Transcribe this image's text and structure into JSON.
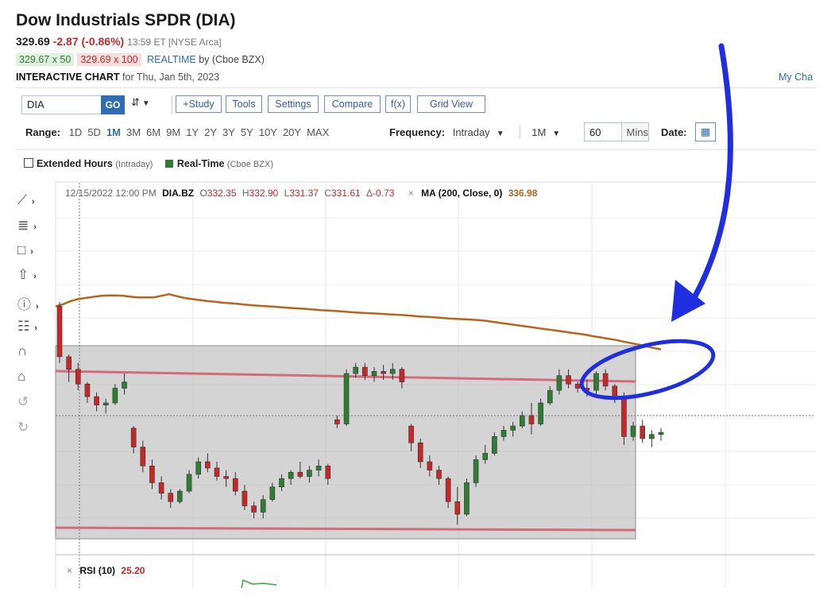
{
  "header": {
    "title": "Dow Industrials SPDR (DIA)",
    "last": "329.69",
    "change": "-2.87 (-0.86%)",
    "time_exchange": "13:59 ET [NYSE Arca]",
    "bid": "329.67 x 50",
    "ask": "329.69 x 100",
    "realtime": "REALTIME",
    "realtime_by": "by (Cboe BZX)",
    "interactive_label": "INTERACTIVE CHART",
    "interactive_date": "for Thu, Jan 5th, 2023",
    "my_charts": "My Cha"
  },
  "toolbar": {
    "symbol_value": "DIA",
    "go_label": "GO",
    "chart_type_icon": "candlestick-icon",
    "study": "+Study",
    "tools": "Tools",
    "settings": "Settings",
    "compare": "Compare",
    "fx": "f(x)",
    "grid_view": "Grid View"
  },
  "range": {
    "label": "Range:",
    "options": [
      "1D",
      "5D",
      "1M",
      "3M",
      "6M",
      "9M",
      "1Y",
      "2Y",
      "3Y",
      "5Y",
      "10Y",
      "20Y",
      "MAX"
    ],
    "selected": "1M"
  },
  "frequency": {
    "label": "Frequency:",
    "value": "Intraday",
    "period": "1M",
    "mins_value": "60",
    "mins_unit": "Mins",
    "date_label": "Date:"
  },
  "options": {
    "extended": "Extended Hours",
    "extended_note": "(Intraday)",
    "realtime": "Real-Time",
    "realtime_note": "(Cboe BZX)"
  },
  "side_tools": [
    "line-draw-icon",
    "fib-icon",
    "rectangle-icon",
    "arrow-up-icon",
    "help-icon",
    "layers-icon",
    "magnet-icon",
    "unlock-icon",
    "undo-icon",
    "redo-icon"
  ],
  "colors": {
    "up": "#2e7d32",
    "down": "#c62828",
    "ma": "#b5651d",
    "annotation": "#1f2fe0",
    "box_fill": "#bdbdbd",
    "channel": "#d46a7a",
    "accent": "#2f6db5"
  },
  "chart_data": {
    "type": "candlestick",
    "info": {
      "datetime": "12/15/2022 12:00 PM",
      "symbol": "DIA.BZ",
      "o_label": "O",
      "open": "332.35",
      "h_label": "H",
      "high": "332.90",
      "l_label": "L",
      "low": "331.37",
      "c_label": "C",
      "close": "331.61",
      "d_label": "Δ",
      "delta": "-0.73",
      "ma_label": "MA (200, Close, 0)",
      "ma_value": "336.98"
    },
    "rsi": {
      "label": "RSI (10)",
      "value": "25.20"
    },
    "ylim": [
      326.0,
      340.0
    ],
    "ma_200": [
      337.6,
      337.7,
      337.85,
      337.95,
      338.0,
      338.05,
      338.1,
      338.12,
      338.12,
      338.1,
      338.05,
      338.02,
      338.02,
      338.03,
      338.1,
      338.18,
      338.08,
      338.0,
      337.95,
      337.9,
      337.85,
      337.82,
      337.78,
      337.75,
      337.72,
      337.68,
      337.65,
      337.62,
      337.6,
      337.58,
      337.55,
      337.52,
      337.5,
      337.48,
      337.45,
      337.42,
      337.4,
      337.38,
      337.35,
      337.32,
      337.3,
      337.28,
      337.26,
      337.24,
      337.22,
      337.2,
      337.18,
      337.15,
      337.12,
      337.1,
      337.08,
      337.05,
      337.02,
      337.0,
      336.98,
      336.96,
      336.94,
      336.9,
      336.85,
      336.8,
      336.75,
      336.7,
      336.65,
      336.6,
      336.55,
      336.5,
      336.45,
      336.4,
      336.35,
      336.3,
      336.25,
      336.18,
      336.12,
      336.06,
      336.0,
      335.92,
      335.85,
      335.78,
      335.7,
      335.62,
      335.55
    ],
    "candles": [
      {
        "o": 337.6,
        "h": 337.8,
        "l": 334.9,
        "c": 335.2
      },
      {
        "o": 335.2,
        "h": 335.3,
        "l": 334.0,
        "c": 334.6
      },
      {
        "o": 334.6,
        "h": 334.9,
        "l": 333.6,
        "c": 333.9
      },
      {
        "o": 333.9,
        "h": 334.0,
        "l": 333.0,
        "c": 333.3
      },
      {
        "o": 333.3,
        "h": 333.5,
        "l": 332.6,
        "c": 332.9
      },
      {
        "o": 332.9,
        "h": 333.2,
        "l": 332.5,
        "c": 333.0
      },
      {
        "o": 333.0,
        "h": 333.9,
        "l": 332.9,
        "c": 333.7
      },
      {
        "o": 333.7,
        "h": 334.4,
        "l": 333.4,
        "c": 334.0
      },
      {
        "o": 331.8,
        "h": 331.9,
        "l": 330.6,
        "c": 330.9
      },
      {
        "o": 330.9,
        "h": 331.2,
        "l": 329.7,
        "c": 330.0
      },
      {
        "o": 330.0,
        "h": 330.3,
        "l": 328.9,
        "c": 329.2
      },
      {
        "o": 329.2,
        "h": 329.5,
        "l": 328.4,
        "c": 328.7
      },
      {
        "o": 328.7,
        "h": 328.9,
        "l": 328.0,
        "c": 328.3
      },
      {
        "o": 328.3,
        "h": 328.9,
        "l": 328.2,
        "c": 328.8
      },
      {
        "o": 328.8,
        "h": 329.8,
        "l": 328.7,
        "c": 329.6
      },
      {
        "o": 329.6,
        "h": 330.4,
        "l": 329.4,
        "c": 330.2
      },
      {
        "o": 330.2,
        "h": 330.6,
        "l": 329.7,
        "c": 329.9
      },
      {
        "o": 329.9,
        "h": 330.2,
        "l": 329.3,
        "c": 329.5
      },
      {
        "o": 329.5,
        "h": 329.8,
        "l": 329.0,
        "c": 329.4
      },
      {
        "o": 329.4,
        "h": 329.7,
        "l": 328.6,
        "c": 328.8
      },
      {
        "o": 328.8,
        "h": 329.1,
        "l": 327.9,
        "c": 328.1
      },
      {
        "o": 328.1,
        "h": 328.3,
        "l": 327.5,
        "c": 327.8
      },
      {
        "o": 327.8,
        "h": 328.6,
        "l": 327.5,
        "c": 328.4
      },
      {
        "o": 328.4,
        "h": 329.2,
        "l": 328.3,
        "c": 329.0
      },
      {
        "o": 329.0,
        "h": 329.6,
        "l": 328.8,
        "c": 329.4
      },
      {
        "o": 329.4,
        "h": 329.8,
        "l": 329.1,
        "c": 329.7
      },
      {
        "o": 329.7,
        "h": 330.2,
        "l": 329.4,
        "c": 329.5
      },
      {
        "o": 329.5,
        "h": 330.0,
        "l": 329.2,
        "c": 329.8
      },
      {
        "o": 329.8,
        "h": 330.3,
        "l": 329.5,
        "c": 330.0
      },
      {
        "o": 330.0,
        "h": 330.1,
        "l": 329.1,
        "c": 329.4
      },
      {
        "o": 332.2,
        "h": 332.4,
        "l": 331.8,
        "c": 332.0
      },
      {
        "o": 332.0,
        "h": 334.6,
        "l": 331.9,
        "c": 334.4
      },
      {
        "o": 334.4,
        "h": 334.9,
        "l": 334.2,
        "c": 334.7
      },
      {
        "o": 334.7,
        "h": 334.9,
        "l": 334.1,
        "c": 334.3
      },
      {
        "o": 334.3,
        "h": 334.7,
        "l": 334.0,
        "c": 334.5
      },
      {
        "o": 334.5,
        "h": 334.8,
        "l": 334.1,
        "c": 334.4
      },
      {
        "o": 334.4,
        "h": 334.9,
        "l": 334.1,
        "c": 334.6
      },
      {
        "o": 334.6,
        "h": 334.7,
        "l": 333.7,
        "c": 334.0
      },
      {
        "o": 331.9,
        "h": 332.0,
        "l": 330.7,
        "c": 331.1
      },
      {
        "o": 331.1,
        "h": 331.3,
        "l": 329.9,
        "c": 330.2
      },
      {
        "o": 330.2,
        "h": 330.5,
        "l": 329.5,
        "c": 329.8
      },
      {
        "o": 329.8,
        "h": 330.0,
        "l": 329.1,
        "c": 329.4
      },
      {
        "o": 329.4,
        "h": 329.5,
        "l": 328.0,
        "c": 328.3
      },
      {
        "o": 328.3,
        "h": 329.0,
        "l": 327.2,
        "c": 327.7
      },
      {
        "o": 327.7,
        "h": 329.4,
        "l": 327.6,
        "c": 329.2
      },
      {
        "o": 329.2,
        "h": 330.5,
        "l": 329.0,
        "c": 330.3
      },
      {
        "o": 330.3,
        "h": 331.0,
        "l": 330.1,
        "c": 330.6
      },
      {
        "o": 330.6,
        "h": 331.6,
        "l": 330.5,
        "c": 331.4
      },
      {
        "o": 331.4,
        "h": 331.9,
        "l": 331.2,
        "c": 331.7
      },
      {
        "o": 331.7,
        "h": 332.1,
        "l": 331.4,
        "c": 331.9
      },
      {
        "o": 331.9,
        "h": 332.6,
        "l": 331.8,
        "c": 332.4
      },
      {
        "o": 332.4,
        "h": 333.0,
        "l": 331.5,
        "c": 332.0
      },
      {
        "o": 332.0,
        "h": 333.2,
        "l": 331.9,
        "c": 333.0
      },
      {
        "o": 333.0,
        "h": 333.8,
        "l": 332.9,
        "c": 333.6
      },
      {
        "o": 333.6,
        "h": 334.6,
        "l": 333.4,
        "c": 334.3
      },
      {
        "o": 334.3,
        "h": 334.6,
        "l": 333.7,
        "c": 333.9
      },
      {
        "o": 333.9,
        "h": 334.0,
        "l": 333.5,
        "c": 333.7
      },
      {
        "o": 333.7,
        "h": 334.1,
        "l": 333.3,
        "c": 333.6
      },
      {
        "o": 333.6,
        "h": 334.5,
        "l": 333.4,
        "c": 334.4
      },
      {
        "o": 334.4,
        "h": 334.6,
        "l": 333.6,
        "c": 333.8
      },
      {
        "o": 333.8,
        "h": 333.9,
        "l": 333.0,
        "c": 333.2
      },
      {
        "o": 333.2,
        "h": 333.5,
        "l": 331.0,
        "c": 331.4
      },
      {
        "o": 331.4,
        "h": 332.1,
        "l": 331.2,
        "c": 331.9
      },
      {
        "o": 331.9,
        "h": 332.2,
        "l": 331.1,
        "c": 331.3
      },
      {
        "o": 331.3,
        "h": 331.7,
        "l": 330.9,
        "c": 331.5
      },
      {
        "o": 331.5,
        "h": 331.8,
        "l": 331.2,
        "c": 331.6
      }
    ]
  }
}
